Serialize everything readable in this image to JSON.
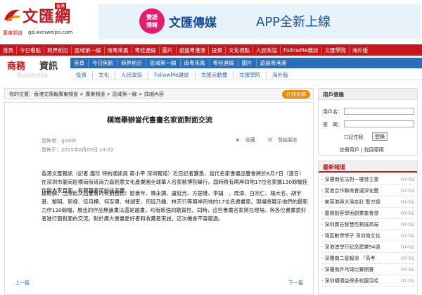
{
  "logo": {
    "name": "文匯網",
    "badge": "香港",
    "sub": "廣東頻道",
    "url": "gd.wenweipo.com"
  },
  "banner": {
    "badge_line1": "雙語",
    "badge_line2": "播報",
    "brand": "文匯傳媒",
    "slogan": "APP全新上線"
  },
  "nav_main": [
    "首頁",
    "今日看點",
    "商界前沿",
    "區域第一線",
    "南粵來風",
    "粵桂連線",
    "圖片",
    "遊遍粵港澳",
    "投資",
    "文化視點",
    "人民政協",
    "FollowMe雜誌",
    "文匯學院",
    "海外版"
  ],
  "section": {
    "brand_a": "商務",
    "brand_b": "資訊",
    "brand_en": "Business",
    "row1": [
      "首頁",
      "今日焦點",
      "商界前沿",
      "區域第一線",
      "南粵來風",
      "粵桂連線",
      "圖片",
      "遊遍粵港澳"
    ],
    "row2": [
      "投資",
      "文化",
      "人民政協",
      "FollowMe雜誌",
      "文匯活動播",
      "文匯學院",
      "海外版"
    ]
  },
  "breadcrumb": {
    "text": "你的位置：香港文匯報廣東頻道 > 廣東頻道 > 區域第一線 > 詳細內容",
    "button": "在线投稿"
  },
  "article": {
    "title": "横崗舉辦當代書畫名家面對面交流",
    "author": "發佈者：gzedit",
    "time": "發佈于：2015年6月05日 14:22",
    "fav": "收藏",
    "share": "發給朋友",
    "p1": "香港文匯報訊（記者 龐珍 特約通訊員 蔣小平 深圳報道）近日記者獲悉，當代名家書畫品鑒會將於6月7日（週日）在深圳市龍崗區横崗街道海力嘉創意文化產業園全球華人名家藝博院舉行。屆時將有兩岸四地17位名家攜130餘幅佳作與大家見面。有興趣者可前往品鑒。",
    "p2": "據瞭解，出席此次品鑒會的有劉國松、歐豪年、陳永鏘、盧延光、方楚雄、李鎮　、周濤、白宗仁、楊大名、胡宇基、黎明、新禄、伍月樺、何百里、林湖奎、司徒乃鍾、林天行等兩岸四地的17位名書畫家。現場將展示他們的最新力作130餘幅，展出的作品無論畫法還是題畫，均有較強的觀賞性。同時，這些書畫名家將在現場，與各位書畫愛好者進行面對面的交流。對於廣大書畫愛好者和收藏者來說，這次機會不容錯過。",
    "prev": "上一篇",
    "next": "下一篇"
  },
  "login": {
    "title": "用戶登錄",
    "user_label": "用戶名：",
    "pass_label": "密　碼：",
    "remember": "記住我",
    "submit": "登錄",
    "links": "註冊用戶 | 找回密碼"
  },
  "news": {
    "title": "最新報道",
    "items": [
      {
        "t": "深樓南依法對一樓發主重",
        "d": "07-03"
      },
      {
        "t": "莞港合作聯席會議深化雙",
        "d": "07-03"
      },
      {
        "t": "東莞港與大灣走壯 警方調",
        "d": "07-02"
      },
      {
        "t": "靈務創客學術創業畜會發",
        "d": "07-02"
      },
      {
        "t": "深圳廣告智慧性數據高端",
        "d": "07-02"
      },
      {
        "t": "灣區數學學子 深圳南文化",
        "d": "07-02"
      },
      {
        "t": "深港澳學行紀念建業94週",
        "d": "07-02"
      },
      {
        "t": "深樓南二星報道 『高考",
        "d": "07-01"
      },
      {
        "t": "深樓南乒乓球比賽開賽",
        "d": "07-01"
      },
      {
        "t": "深圳構環益保多校園羽毛",
        "d": "07-01"
      }
    ]
  }
}
